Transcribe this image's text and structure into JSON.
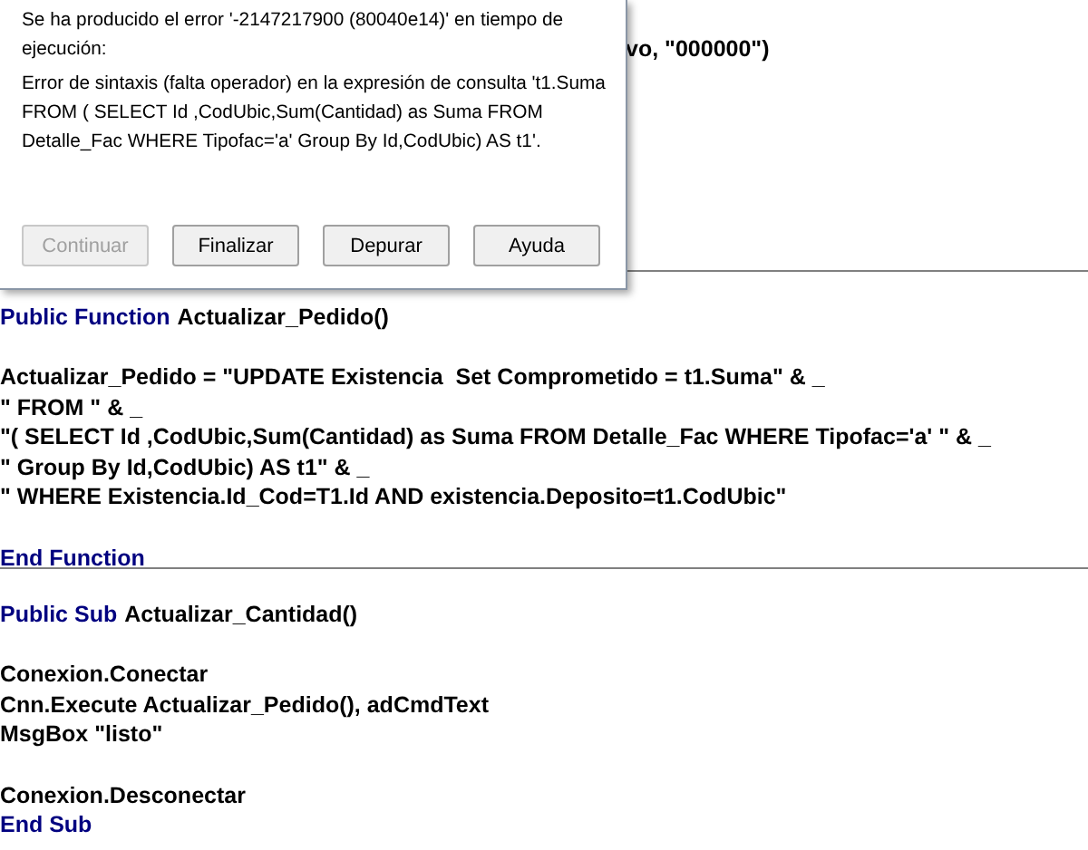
{
  "code_lines": [
    {
      "kind": "code",
      "segments": [
        {
          "text": "vo, \"000000\")",
          "kind": "plain"
        }
      ]
    },
    {
      "kind": "blank"
    },
    {
      "kind": "blank"
    },
    {
      "kind": "blank"
    },
    {
      "kind": "blank"
    },
    {
      "kind": "blank"
    },
    {
      "kind": "blank"
    },
    {
      "kind": "blank"
    },
    {
      "kind": "separator"
    },
    {
      "kind": "code",
      "segments": [
        {
          "text": "Public Function",
          "kind": "keyword"
        },
        {
          "text": "Actualizar_Pedido()",
          "kind": "plain"
        }
      ]
    },
    {
      "kind": "blank"
    },
    {
      "kind": "code",
      "segments": [
        {
          "text": "Actualizar_Pedido = \"UPDATE Existencia  Set Comprometido = t1.Suma\" & _",
          "kind": "plain"
        }
      ]
    },
    {
      "kind": "code",
      "segments": [
        {
          "text": "\" FROM \" & _",
          "kind": "plain"
        }
      ]
    },
    {
      "kind": "code",
      "segments": [
        {
          "text": "\"( SELECT Id ,CodUbic,Sum(Cantidad) as Suma FROM Detalle_Fac WHERE Tipofac='a' \" & _",
          "kind": "plain"
        }
      ]
    },
    {
      "kind": "code",
      "segments": [
        {
          "text": "\" Group By Id,CodUbic) AS t1\" & _",
          "kind": "plain"
        }
      ]
    },
    {
      "kind": "code",
      "segments": [
        {
          "text": "\" WHERE Existencia.Id_Cod=T1.Id AND existencia.Deposito=t1.CodUbic\"",
          "kind": "plain"
        }
      ]
    },
    {
      "kind": "blank"
    },
    {
      "kind": "code",
      "segments": [
        {
          "text": "End Function",
          "kind": "keyword"
        }
      ]
    },
    {
      "kind": "separator"
    },
    {
      "kind": "code",
      "segments": [
        {
          "text": "Public Sub",
          "kind": "keyword"
        },
        {
          "text": "Actualizar_Cantidad()",
          "kind": "plain"
        }
      ]
    },
    {
      "kind": "blank"
    },
    {
      "kind": "code",
      "segments": [
        {
          "text": "Conexion.Conectar",
          "kind": "plain"
        }
      ]
    },
    {
      "kind": "code",
      "segments": [
        {
          "text": "Cnn.Execute Actualizar_Pedido(), adCmdText",
          "kind": "plain"
        }
      ]
    },
    {
      "kind": "code",
      "segments": [
        {
          "text": "MsgBox \"listo\"",
          "kind": "plain"
        }
      ]
    },
    {
      "kind": "blank"
    },
    {
      "kind": "code",
      "segments": [
        {
          "text": "Conexion.Desconectar",
          "kind": "plain"
        }
      ]
    },
    {
      "kind": "code",
      "segments": [
        {
          "text": "End Sub",
          "kind": "keyword"
        }
      ]
    }
  ],
  "dialog": {
    "message": "Se ha producido el error '-2147217900 (80040e14)' en tiempo de ejecución:",
    "detail": "Error de sintaxis (falta operador) en la expresión de consulta 't1.Suma FROM ( SELECT Id ,CodUbic,Sum(Cantidad) as Suma FROM Detalle_Fac WHERE Tipofac='a'  Group By Id,CodUbic) AS t1'.",
    "buttons": [
      {
        "label": "Continuar",
        "disabled": true
      },
      {
        "label": "Finalizar",
        "disabled": false
      },
      {
        "label": "Depurar",
        "disabled": false
      },
      {
        "label": "Ayuda",
        "disabled": false
      }
    ]
  }
}
